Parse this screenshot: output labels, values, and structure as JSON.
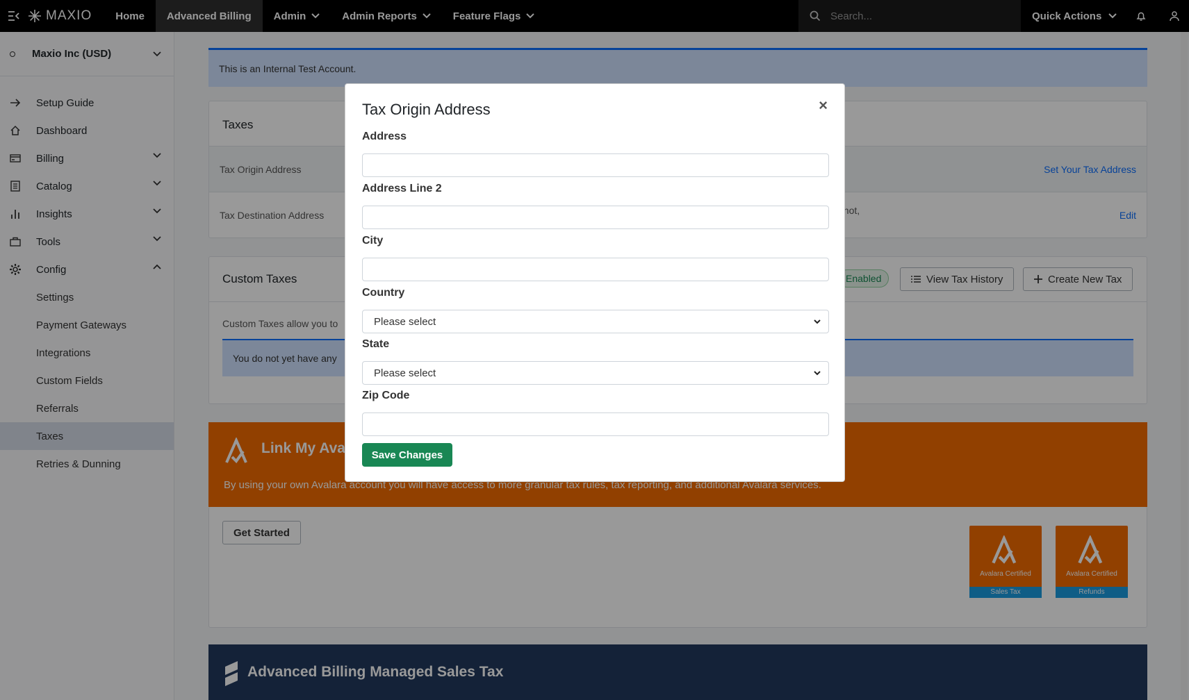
{
  "topbar": {
    "logo": "MAXIO",
    "nav": [
      "Home",
      "Advanced Billing",
      "Admin",
      "Admin Reports",
      "Feature Flags"
    ],
    "search_placeholder": "Search...",
    "quick_actions": "Quick Actions"
  },
  "sidebar": {
    "org": "Maxio Inc (USD)",
    "items": [
      "Setup Guide",
      "Dashboard",
      "Billing",
      "Catalog",
      "Insights",
      "Tools",
      "Config"
    ],
    "config_sub": [
      "Settings",
      "Payment Gateways",
      "Integrations",
      "Custom Fields",
      "Referrals",
      "Taxes",
      "Retries & Dunning"
    ]
  },
  "main": {
    "banner": "This is an Internal Test Account.",
    "taxes_title": "Taxes",
    "tax_origin_label": "Tax Origin Address",
    "tax_origin_link": "Set Your Tax Address",
    "tax_dest_label": "Tax Destination Address",
    "tax_dest_fragment": "f not,",
    "tax_dest_link": "Edit",
    "custom_taxes_title": "Custom Taxes",
    "enabled_badge": "Enabled",
    "view_history": "View Tax History",
    "create_tax": "Create New Tax",
    "custom_taxes_desc": "Custom Taxes allow you to",
    "no_taxes_info": "You do not yet have any",
    "avalara_title": "Link My Avala",
    "avalara_desc": "By using your own Avalara account you will have access to more granular tax rules, tax reporting, and additional Avalara services.",
    "get_started": "Get Started",
    "cert_sales_label": "Avalara Certified",
    "cert_sales_strip": "Sales Tax",
    "cert_refunds_label": "Avalara Certified",
    "cert_refunds_strip": "Refunds",
    "managed_title": "Advanced Billing Managed Sales Tax"
  },
  "modal": {
    "title": "Tax Origin Address",
    "close": "×",
    "address_label": "Address",
    "address2_label": "Address Line 2",
    "city_label": "City",
    "country_label": "Country",
    "country_value": "Please select",
    "state_label": "State",
    "state_value": "Please select",
    "zip_label": "Zip Code",
    "save": "Save Changes"
  }
}
